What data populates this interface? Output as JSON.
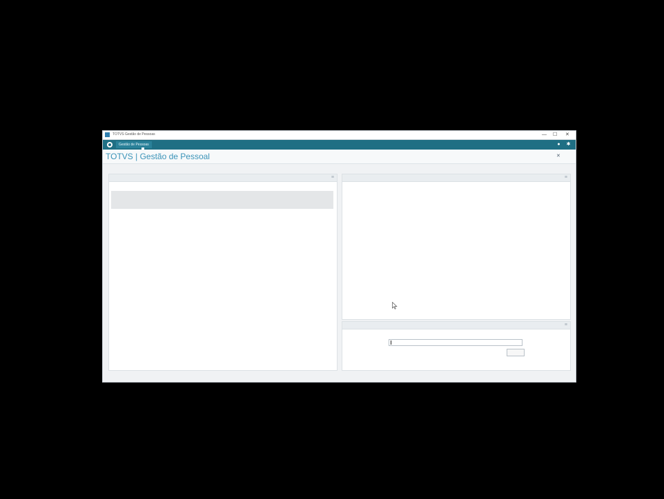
{
  "window": {
    "title": "TOTVS Gestão de Pessoas",
    "min": "—",
    "max": "☐",
    "close": "✕"
  },
  "header": {
    "tab_label": "Gestão de Pessoas",
    "icon_help": "help-icon",
    "icon_settings": "gear-icon"
  },
  "app": {
    "title": "TOTVS | Gestão de Pessoal",
    "info": [
      "",
      "",
      "",
      "",
      "✕"
    ]
  },
  "left_panel": {
    "title": "",
    "collapse": "≡",
    "columns": [
      "",
      "",
      "",
      ""
    ],
    "rows": [
      [
        "",
        "",
        "",
        ""
      ],
      [
        "",
        "",
        "",
        ""
      ],
      [
        "",
        "",
        "",
        ""
      ],
      [
        "",
        "",
        "",
        ""
      ]
    ]
  },
  "right_panel": {
    "title": "",
    "collapse": "≡"
  },
  "bottom_panel": {
    "title": "",
    "collapse": "≡",
    "input_value": "",
    "confirm_label": ""
  }
}
